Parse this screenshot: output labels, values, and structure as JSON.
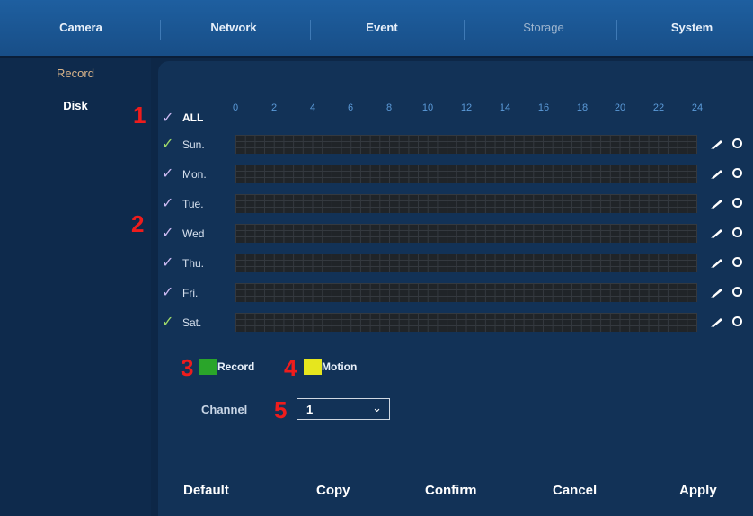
{
  "tabs": [
    {
      "label": "Camera",
      "active": false
    },
    {
      "label": "Network",
      "active": false
    },
    {
      "label": "Event",
      "active": false
    },
    {
      "label": "Storage",
      "active": true
    },
    {
      "label": "System",
      "active": false
    }
  ],
  "sidebar": {
    "items": [
      {
        "label": "Record",
        "active": true
      },
      {
        "label": "Disk",
        "active": false
      }
    ]
  },
  "schedule": {
    "all_label": "ALL",
    "hours": [
      "0",
      "2",
      "4",
      "6",
      "8",
      "10",
      "12",
      "14",
      "16",
      "18",
      "20",
      "22",
      "24"
    ],
    "days": [
      "Sun.",
      "Mon.",
      "Tue.",
      "Wed",
      "Thu.",
      "Fri.",
      "Sat."
    ],
    "check_glyph": "✓"
  },
  "legend": {
    "record_label": "Record",
    "motion_label": "Motion",
    "record_color": "#2aa52a",
    "motion_color": "#e6e61e"
  },
  "channel": {
    "label": "Channel",
    "value": "1"
  },
  "buttons": {
    "default": "Default",
    "copy": "Copy",
    "confirm": "Confirm",
    "cancel": "Cancel",
    "apply": "Apply"
  },
  "markers": [
    "1",
    "2",
    "3",
    "4",
    "5"
  ],
  "icons": {
    "edit": "pencil-icon",
    "settings": "circle-settings-icon",
    "dropdown": "chevron-down-icon"
  },
  "colors": {
    "header": "#1e5fa0",
    "background": "#0d2747",
    "panel": "#123257",
    "grid": "#202428",
    "hour_text": "#5b9ad8",
    "marker": "#ee1c1c"
  }
}
